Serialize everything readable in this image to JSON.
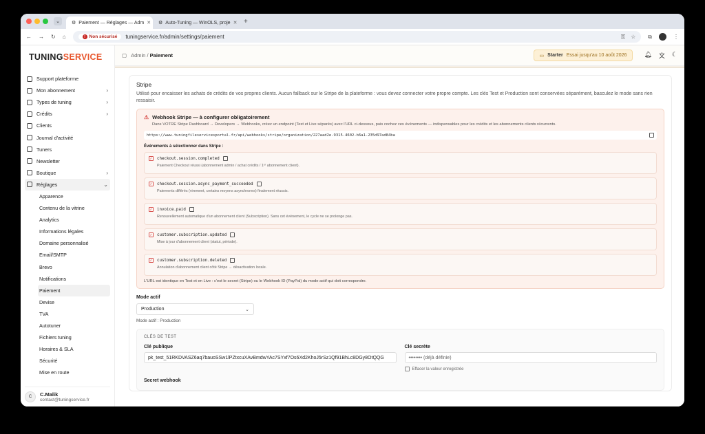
{
  "browser": {
    "tabs": [
      {
        "title": "Paiement — Réglages — Adm",
        "active": true
      },
      {
        "title": "Auto-Tuning — WinOLS, proje",
        "active": false
      }
    ],
    "insecure_label": "Non sécurisé",
    "url": "tuningservice.fr/admin/settings/paiement"
  },
  "sidebar": {
    "logo_main": "TUNING",
    "logo_accent": "SERVICE",
    "items": [
      {
        "label": "Support plateforme",
        "icon": "support-icon"
      },
      {
        "label": "Mon abonnement",
        "icon": "card-icon",
        "chevron": true
      },
      {
        "label": "Types de tuning",
        "icon": "tuning-icon",
        "chevron": true
      },
      {
        "label": "Crédits",
        "icon": "credits-icon",
        "chevron": true
      },
      {
        "label": "Clients",
        "icon": "users-icon"
      },
      {
        "label": "Journal d'activité",
        "icon": "history-icon"
      },
      {
        "label": "Tuners",
        "icon": "wrench-icon"
      },
      {
        "label": "Newsletter",
        "icon": "mail-icon"
      },
      {
        "label": "Boutique",
        "icon": "shop-icon",
        "chevron": true
      },
      {
        "label": "Réglages",
        "icon": "gear-icon",
        "chevron": true
      }
    ],
    "settings_sub": [
      "Apparence",
      "Contenu de la vitrine",
      "Analytics",
      "Informations légales",
      "Domaine personnalisé",
      "Email/SMTP",
      "Brevo",
      "Notifications",
      "Paiement",
      "Devise",
      "TVA",
      "Autotuner",
      "Fichiers tuning",
      "Horaires & SLA",
      "Sécurité",
      "Mise en route"
    ],
    "user": {
      "initial": "C",
      "name": "C.Malik",
      "email": "contact@tuningservice.fr"
    }
  },
  "topbar": {
    "breadcrumb_root": "Admin",
    "breadcrumb_sep": "/",
    "breadcrumb_current": "Paiement",
    "plan_name": "Starter",
    "plan_trial": "Essai jusqu'au 10 août 2026"
  },
  "stripe": {
    "title": "Stripe",
    "description": "Utilisé pour encaisser les achats de crédits de vos propres clients. Aucun fallback sur le Stripe de la plateforme : vous devez connecter votre propre compte. Les clés Test et Production sont conservées séparément, basculez le mode sans rien ressaisir.",
    "webhook_title": "Webhook Stripe — à configurer obligatoirement",
    "webhook_sub": "Dans VOTRE Stripe Dashboard → Developers → Webhooks, créez un endpoint (Test et Live séparés) avec l'URL ci-dessous, puis cochez ces événements — indispensables pour les crédits et les abonnements clients récurrents.",
    "webhook_url": "https://www.tuningfileservicesportal.fr/api/webhooks/stripe/organization/227aad2e-9315-4602-b6a1-235d97ad84ba",
    "events_label": "Événements à sélectionner dans Stripe :",
    "events": [
      {
        "code": "checkout.session.completed",
        "desc": "Paiement Checkout réussi (abonnement admin / achat crédits / 1ᵉʳ abonnement client)."
      },
      {
        "code": "checkout.session.async_payment_succeeded",
        "desc": "Paiements différés (virement, certains moyens asynchrones) finalement réussis."
      },
      {
        "code": "invoice.paid",
        "desc": "Renouvellement automatique d'un abonnement client (Subscription). Sans cet événement, le cycle ne se prolonge pas."
      },
      {
        "code": "customer.subscription.updated",
        "desc": "Mise à jour d'abonnement client (statut, période)."
      },
      {
        "code": "customer.subscription.deleted",
        "desc": "Annulation d'abonnement client côté Stripe → désactivation locale."
      }
    ],
    "note": "L'URL est identique en Test et en Live : c'est le secret (Stripe) ou le Webhook ID (PayPal) du mode actif qui doit correspondre.",
    "mode_label": "Mode actif",
    "mode_value": "Production",
    "mode_hint": "Mode actif : Production",
    "test_keys_label": "CLÉS DE TEST",
    "public_key_label": "Clé publique",
    "public_key_value": "pk_test_51RKDVASZ6aq7bauoSSw1lPZtxcuXAvBmdwYAc7SYxf7Os6Xd2KhoJ5rSz1Qf91BhLc8DGy8OtQQG",
    "secret_key_label": "Clé secrète",
    "secret_key_placeholder": "•••••••• (déjà définie)",
    "clear_label": "Effacer la valeur enregistrée",
    "webhook_secret_label": "Secret webhook"
  }
}
